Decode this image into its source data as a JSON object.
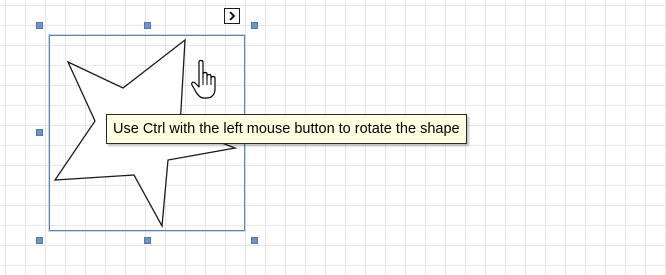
{
  "tooltip": {
    "text": "Use Ctrl with the left mouse button to rotate the shape"
  },
  "shape": {
    "kind": "star",
    "points": 5,
    "selected": true
  },
  "icons": {
    "smart_tag": "chevron-right-icon",
    "cursor": "hand-pointer-icon"
  },
  "colors": {
    "selection_frame": "#5d84b8",
    "handle": "#6f93c5",
    "tooltip_background": "#ffffe1",
    "grid_line": "#e6e6e6"
  }
}
